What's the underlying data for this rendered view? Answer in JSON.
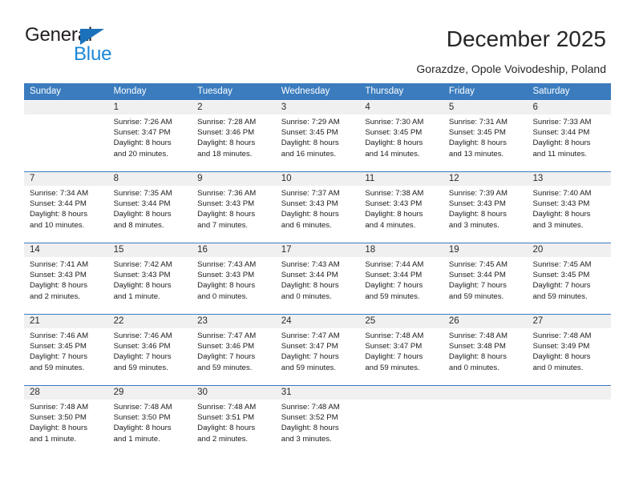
{
  "brand": {
    "name_top": "General",
    "name_bottom": "Blue",
    "triangle_color": "#1b72bb",
    "blue_color": "#1b87d8"
  },
  "header": {
    "title": "December 2025",
    "subtitle": "Gorazdze, Opole Voivodeship, Poland"
  },
  "calendar": {
    "accent_color": "#3b7cbe",
    "daynum_band_color": "#f0f0f0",
    "weekday_headers": [
      "Sunday",
      "Monday",
      "Tuesday",
      "Wednesday",
      "Thursday",
      "Friday",
      "Saturday"
    ],
    "weeks": [
      [
        {
          "day": "",
          "lines": []
        },
        {
          "day": "1",
          "lines": [
            "Sunrise: 7:26 AM",
            "Sunset: 3:47 PM",
            "Daylight: 8 hours",
            "and 20 minutes."
          ]
        },
        {
          "day": "2",
          "lines": [
            "Sunrise: 7:28 AM",
            "Sunset: 3:46 PM",
            "Daylight: 8 hours",
            "and 18 minutes."
          ]
        },
        {
          "day": "3",
          "lines": [
            "Sunrise: 7:29 AM",
            "Sunset: 3:45 PM",
            "Daylight: 8 hours",
            "and 16 minutes."
          ]
        },
        {
          "day": "4",
          "lines": [
            "Sunrise: 7:30 AM",
            "Sunset: 3:45 PM",
            "Daylight: 8 hours",
            "and 14 minutes."
          ]
        },
        {
          "day": "5",
          "lines": [
            "Sunrise: 7:31 AM",
            "Sunset: 3:45 PM",
            "Daylight: 8 hours",
            "and 13 minutes."
          ]
        },
        {
          "day": "6",
          "lines": [
            "Sunrise: 7:33 AM",
            "Sunset: 3:44 PM",
            "Daylight: 8 hours",
            "and 11 minutes."
          ]
        }
      ],
      [
        {
          "day": "7",
          "lines": [
            "Sunrise: 7:34 AM",
            "Sunset: 3:44 PM",
            "Daylight: 8 hours",
            "and 10 minutes."
          ]
        },
        {
          "day": "8",
          "lines": [
            "Sunrise: 7:35 AM",
            "Sunset: 3:44 PM",
            "Daylight: 8 hours",
            "and 8 minutes."
          ]
        },
        {
          "day": "9",
          "lines": [
            "Sunrise: 7:36 AM",
            "Sunset: 3:43 PM",
            "Daylight: 8 hours",
            "and 7 minutes."
          ]
        },
        {
          "day": "10",
          "lines": [
            "Sunrise: 7:37 AM",
            "Sunset: 3:43 PM",
            "Daylight: 8 hours",
            "and 6 minutes."
          ]
        },
        {
          "day": "11",
          "lines": [
            "Sunrise: 7:38 AM",
            "Sunset: 3:43 PM",
            "Daylight: 8 hours",
            "and 4 minutes."
          ]
        },
        {
          "day": "12",
          "lines": [
            "Sunrise: 7:39 AM",
            "Sunset: 3:43 PM",
            "Daylight: 8 hours",
            "and 3 minutes."
          ]
        },
        {
          "day": "13",
          "lines": [
            "Sunrise: 7:40 AM",
            "Sunset: 3:43 PM",
            "Daylight: 8 hours",
            "and 3 minutes."
          ]
        }
      ],
      [
        {
          "day": "14",
          "lines": [
            "Sunrise: 7:41 AM",
            "Sunset: 3:43 PM",
            "Daylight: 8 hours",
            "and 2 minutes."
          ]
        },
        {
          "day": "15",
          "lines": [
            "Sunrise: 7:42 AM",
            "Sunset: 3:43 PM",
            "Daylight: 8 hours",
            "and 1 minute."
          ]
        },
        {
          "day": "16",
          "lines": [
            "Sunrise: 7:43 AM",
            "Sunset: 3:43 PM",
            "Daylight: 8 hours",
            "and 0 minutes."
          ]
        },
        {
          "day": "17",
          "lines": [
            "Sunrise: 7:43 AM",
            "Sunset: 3:44 PM",
            "Daylight: 8 hours",
            "and 0 minutes."
          ]
        },
        {
          "day": "18",
          "lines": [
            "Sunrise: 7:44 AM",
            "Sunset: 3:44 PM",
            "Daylight: 7 hours",
            "and 59 minutes."
          ]
        },
        {
          "day": "19",
          "lines": [
            "Sunrise: 7:45 AM",
            "Sunset: 3:44 PM",
            "Daylight: 7 hours",
            "and 59 minutes."
          ]
        },
        {
          "day": "20",
          "lines": [
            "Sunrise: 7:45 AM",
            "Sunset: 3:45 PM",
            "Daylight: 7 hours",
            "and 59 minutes."
          ]
        }
      ],
      [
        {
          "day": "21",
          "lines": [
            "Sunrise: 7:46 AM",
            "Sunset: 3:45 PM",
            "Daylight: 7 hours",
            "and 59 minutes."
          ]
        },
        {
          "day": "22",
          "lines": [
            "Sunrise: 7:46 AM",
            "Sunset: 3:46 PM",
            "Daylight: 7 hours",
            "and 59 minutes."
          ]
        },
        {
          "day": "23",
          "lines": [
            "Sunrise: 7:47 AM",
            "Sunset: 3:46 PM",
            "Daylight: 7 hours",
            "and 59 minutes."
          ]
        },
        {
          "day": "24",
          "lines": [
            "Sunrise: 7:47 AM",
            "Sunset: 3:47 PM",
            "Daylight: 7 hours",
            "and 59 minutes."
          ]
        },
        {
          "day": "25",
          "lines": [
            "Sunrise: 7:48 AM",
            "Sunset: 3:47 PM",
            "Daylight: 7 hours",
            "and 59 minutes."
          ]
        },
        {
          "day": "26",
          "lines": [
            "Sunrise: 7:48 AM",
            "Sunset: 3:48 PM",
            "Daylight: 8 hours",
            "and 0 minutes."
          ]
        },
        {
          "day": "27",
          "lines": [
            "Sunrise: 7:48 AM",
            "Sunset: 3:49 PM",
            "Daylight: 8 hours",
            "and 0 minutes."
          ]
        }
      ],
      [
        {
          "day": "28",
          "lines": [
            "Sunrise: 7:48 AM",
            "Sunset: 3:50 PM",
            "Daylight: 8 hours",
            "and 1 minute."
          ]
        },
        {
          "day": "29",
          "lines": [
            "Sunrise: 7:48 AM",
            "Sunset: 3:50 PM",
            "Daylight: 8 hours",
            "and 1 minute."
          ]
        },
        {
          "day": "30",
          "lines": [
            "Sunrise: 7:48 AM",
            "Sunset: 3:51 PM",
            "Daylight: 8 hours",
            "and 2 minutes."
          ]
        },
        {
          "day": "31",
          "lines": [
            "Sunrise: 7:48 AM",
            "Sunset: 3:52 PM",
            "Daylight: 8 hours",
            "and 3 minutes."
          ]
        },
        {
          "day": "",
          "lines": []
        },
        {
          "day": "",
          "lines": []
        },
        {
          "day": "",
          "lines": []
        }
      ]
    ]
  }
}
